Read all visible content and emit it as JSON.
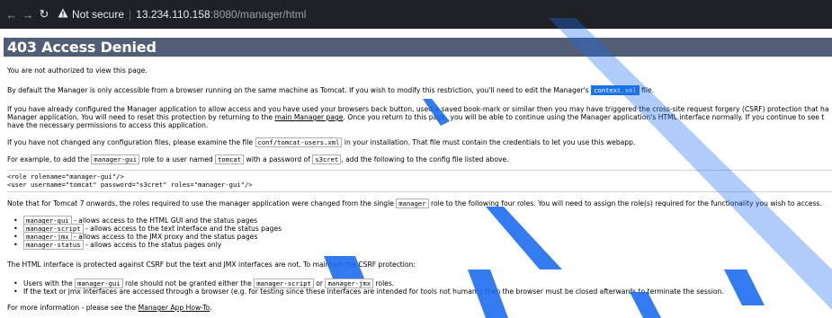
{
  "browser": {
    "not_secure": "Not secure",
    "separator": "|",
    "host": "13.234.110.158",
    "path": ":8080/manager/html"
  },
  "page": {
    "title": "403 Access Denied",
    "p1": "You are not authorized to view this page.",
    "p2a": "By default the Manager is only accessible from a browser running on the same machine as Tomcat. If you wish to modify this restriction, you'll need to edit the Manager's",
    "p2code": "context.xml",
    "p2b": "file.",
    "p3l1": "If you have already configured the Manager application to allow access and you have used your browsers back button, used a saved book-mark or similar then you may have triggered the cross-site request forgery (CSRF) protection that ha",
    "p3l2a": "Manager application. You will need to reset this protection by returning to the",
    "p3link": "main Manager page",
    "p3l2b": ". Once you return to this page, you will be able to continue using the Manager application's HTML interface normally. If you continue to see t",
    "p3l3": "have the necessary permissions to access this application.",
    "p4a": "If you have not changed any configuration files, please examine the file",
    "p4code": "conf/tomcat-users.xml",
    "p4b": "in your installation. That file must contain the credentials to let you use this webapp.",
    "p5a": "For example, to add the",
    "p5code1": "manager-gui",
    "p5b": "role to a user named",
    "p5code2": "tomcat",
    "p5c": "with a password of",
    "p5code3": "s3cret",
    "p5d": ", add the following to the config file listed above.",
    "pre1": "<role rolename=\"manager-gui\"/>",
    "pre2": "<user username=\"tomcat\" password=\"s3cret\" roles=\"manager-gui\"/>",
    "p6a": "Note that for Tomcat 7 onwards, the roles required to use the manager application were changed from the single",
    "p6code": "manager",
    "p6b": "role to the following four roles. You will need to assign the role(s) required for the functionality you wish to access.",
    "roles": [
      {
        "code": "manager-gui",
        "text": " - allows access to the HTML GUI and the status pages"
      },
      {
        "code": "manager-script",
        "text": " - allows access to the text interface and the status pages"
      },
      {
        "code": "manager-jmx",
        "text": " - allows access to the JMX proxy and the status pages"
      },
      {
        "code": "manager-status",
        "text": " - allows access to the status pages only"
      }
    ],
    "p7": "The HTML interface is protected against CSRF but the text and JMX interfaces are not. To maintain the CSRF protection:",
    "csrf1a": "Users with the",
    "csrf1code1": "manager-gui",
    "csrf1b": "role should not be granted either the",
    "csrf1code2": "manager-script",
    "csrf1c": "or",
    "csrf1code3": "manager-jmx",
    "csrf1d": "roles.",
    "csrf2": "If the text or jmx interfaces are accessed through a browser (e.g. for testing since these interfaces are intended for tools not humans) then the browser must be closed afterwards to terminate the session.",
    "p8a": "For more information - please see the",
    "p8link": "Manager App How-To",
    "p8b": "."
  },
  "colors": {
    "title_bar": "#525d76",
    "highlight": "#1a73e8",
    "watermark": "#1e6cf0"
  }
}
